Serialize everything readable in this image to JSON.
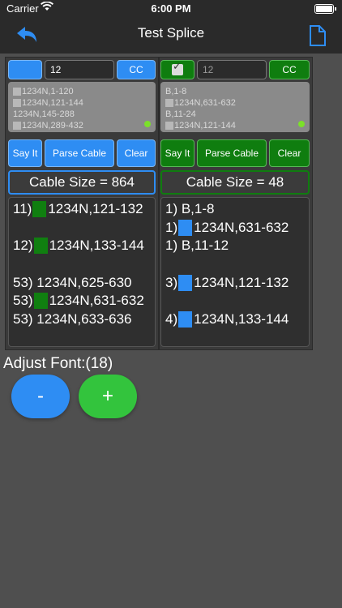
{
  "status_bar": {
    "carrier": "Carrier",
    "time": "6:00 PM"
  },
  "nav": {
    "title": "Test Splice",
    "back_icon": "back-arrow-icon",
    "doc_icon": "document-icon"
  },
  "left": {
    "input_value": "12",
    "cc_label": "CC",
    "list": [
      {
        "text": "1234N,1-120",
        "marker": true
      },
      {
        "text": "1234N,121-144",
        "marker": true
      },
      {
        "text": "1234N,145-288",
        "marker": false
      },
      {
        "text": "1234N,289-432",
        "marker": true
      }
    ],
    "say_it_label": "Say It",
    "parse_label": "Parse Cable",
    "clear_label": "Clear",
    "cable_size": "Cable Size = 864",
    "results": [
      {
        "text": "11) ",
        "rest": "1234N,121-132",
        "marker": "green"
      },
      {
        "text": "",
        "rest": "",
        "marker": ""
      },
      {
        "text": "12) ",
        "rest": "1234N,133-144",
        "marker": "green"
      },
      {
        "text": "",
        "rest": "",
        "marker": ""
      },
      {
        "text": "53) 1234N,625-630",
        "rest": "",
        "marker": ""
      },
      {
        "text": "53) ",
        "rest": "1234N,631-632",
        "marker": "green"
      },
      {
        "text": "53) 1234N,633-636",
        "rest": "",
        "marker": ""
      }
    ]
  },
  "right": {
    "input_value": "12",
    "cc_label": "CC",
    "list": [
      {
        "text": "B,1-8",
        "marker": false
      },
      {
        "text": "1234N,631-632",
        "marker": true
      },
      {
        "text": "B,11-24",
        "marker": false
      },
      {
        "text": "1234N,121-144",
        "marker": true
      }
    ],
    "say_it_label": "Say It",
    "parse_label": "Parse Cable",
    "clear_label": "Clear",
    "cable_size": "Cable Size = 48",
    "results": [
      {
        "text": "1) B,1-8",
        "rest": "",
        "marker": ""
      },
      {
        "text": "1) ",
        "rest": "1234N,631-632",
        "marker": "blue"
      },
      {
        "text": "1) B,11-12",
        "rest": "",
        "marker": ""
      },
      {
        "text": "",
        "rest": "",
        "marker": ""
      },
      {
        "text": "3) ",
        "rest": "1234N,121-132",
        "marker": "blue"
      },
      {
        "text": "",
        "rest": "",
        "marker": ""
      },
      {
        "text": "4) ",
        "rest": "1234N,133-144",
        "marker": "blue"
      }
    ]
  },
  "font": {
    "label": "Adjust Font:(18)",
    "minus": "-",
    "plus": "+"
  },
  "colors": {
    "blue": "#2e8df3",
    "green": "#0f7d0f",
    "lime": "#33c43d"
  }
}
